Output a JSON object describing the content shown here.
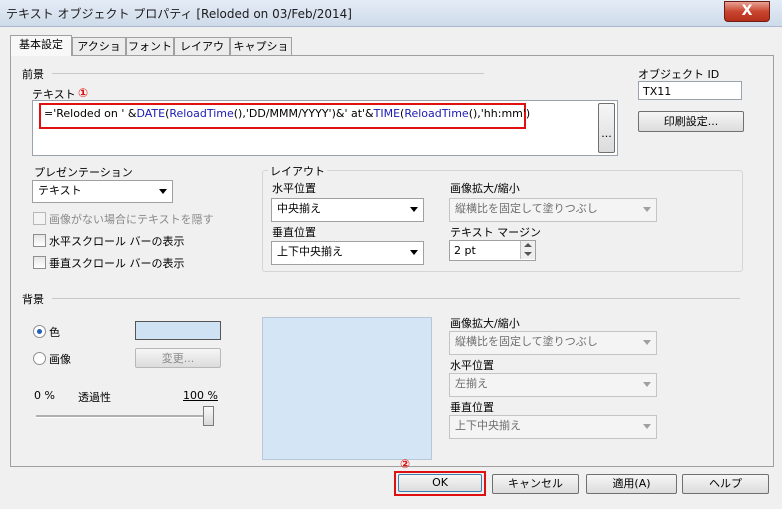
{
  "window": {
    "title": "テキスト オブジェクト プロパティ [Reloded on 03/Feb/2014]",
    "close_glyph": "X"
  },
  "tabs": [
    "基本設定",
    "アクション",
    "フォント",
    "レイアウト",
    "キャプション"
  ],
  "foreground": {
    "section_label": "前景",
    "text_label": "テキスト",
    "annotation_1": "①",
    "formula": {
      "p1": "='Reloded on '  &",
      "p2": "DATE",
      "p3": "(",
      "p4": "ReloadTime",
      "p5": "(),'DD/MMM/YYYY')&' at'&",
      "p6": "TIME",
      "p7": "(",
      "p8": "ReloadTime",
      "p9": "(),'hh:mm')"
    },
    "ellipsis_button": "...",
    "object_id_label": "オブジェクト ID",
    "object_id_value": "TX11",
    "print_settings_button": "印刷設定..."
  },
  "presentation": {
    "label": "プレゼンテーション",
    "selected": "テキスト",
    "options": [
      {
        "label": "画像がない場合にテキストを隠す",
        "checked": false,
        "enabled": false
      },
      {
        "label": "水平スクロール バーの表示",
        "checked": false,
        "enabled": true
      },
      {
        "label": "垂直スクロール バーの表示",
        "checked": false,
        "enabled": true
      }
    ]
  },
  "layout": {
    "group_label": "レイアウト",
    "h_align_label": "水平位置",
    "h_align_value": "中央揃え",
    "v_align_label": "垂直位置",
    "v_align_value": "上下中央揃え",
    "image_stretch_label": "画像拡大/縮小",
    "image_stretch_value": "縦横比を固定して塗りつぶし",
    "text_margin_label": "テキスト マージン",
    "text_margin_value": "2 pt"
  },
  "background": {
    "section_label": "背景",
    "color_label": "色",
    "image_label": "画像",
    "change_button": "変更...",
    "swatch_color": "#cfe2f3",
    "transparency_min": "0 %",
    "transparency_label": "透過性",
    "transparency_max": "100 %",
    "transparency_value": 1.0,
    "image_stretch_label": "画像拡大/縮小",
    "image_stretch_value": "縦横比を固定して塗りつぶし",
    "h_align_label": "水平位置",
    "h_align_value": "左揃え",
    "v_align_label": "垂直位置",
    "v_align_value": "上下中央揃え"
  },
  "footer": {
    "annotation_2": "②",
    "ok": "OK",
    "cancel": "キャンセル",
    "apply": "適用(A)",
    "help": "ヘルプ"
  },
  "colors": {
    "accent_red": "#e01010",
    "formula_blue": "#1a1ab3"
  }
}
